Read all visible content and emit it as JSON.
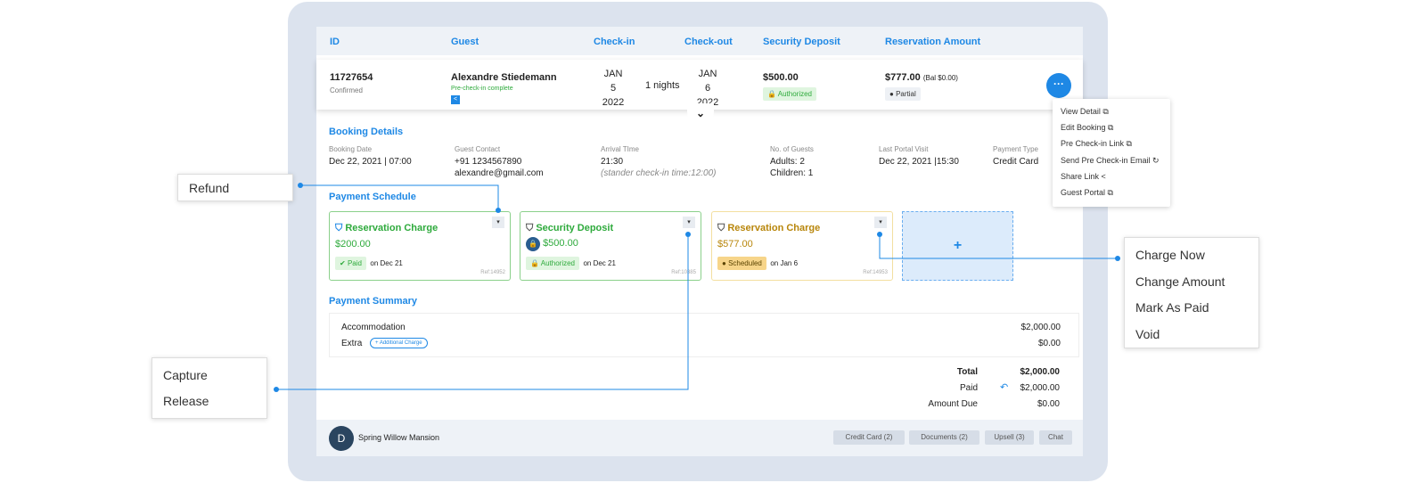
{
  "table": {
    "headers": [
      "ID",
      "Guest",
      "Check-in",
      "Check-out",
      "Security Deposit",
      "Reservation Amount"
    ]
  },
  "booking": {
    "id": "11727654",
    "status": "Confirmed",
    "guest": "Alexandre Stiedemann",
    "precheck": "Pre-check-in complete",
    "checkin": {
      "month": "JAN",
      "day": "5",
      "year": "2022"
    },
    "nights": "1 nights",
    "checkout": {
      "month": "JAN",
      "day": "6",
      "year": "2022"
    },
    "deposit": "$500.00",
    "deposit_status": "Authorized",
    "amount": "$777.00",
    "balance": "(Bal $0.00)",
    "amount_status": "Partial"
  },
  "details": {
    "title": "Booking Details",
    "booking_date_label": "Booking Date",
    "booking_date": "Dec 22, 2021 | 07:00",
    "contact_label": "Guest Contact",
    "phone": "+91 1234567890",
    "email": "alexandre@gmail.com",
    "arrival_label": "Arrival TIme",
    "arrival": "21:30",
    "arrival_note": "(stander check-in time:12:00)",
    "guests_label": "No. of Guests",
    "adults": "Adults: 2",
    "children": "Children: 1",
    "portal_label": "Last Portal Visit",
    "portal": "Dec 22, 2021 |15:30",
    "payment_label": "Payment Type",
    "payment": "Credit Card"
  },
  "menu": [
    "View Detail",
    "Edit Booking",
    "Pre Check-in Link",
    "Send Pre Check-in Email",
    "Share Link",
    "Guest Portal"
  ],
  "schedule": {
    "title": "Payment Schedule",
    "cards": [
      {
        "title": "Reservation Charge",
        "amount": "$200.00",
        "status": "Paid",
        "date": "on Dec 21",
        "ref": "Ref:14952"
      },
      {
        "title": "Security Deposit",
        "amount": "$500.00",
        "status": "Authorized",
        "date": "on Dec 21",
        "ref": "Ref:10385"
      },
      {
        "title": "Reservation Charge",
        "amount": "$577.00",
        "status": "Scheduled",
        "date": "on Jan 6",
        "ref": "Ref:14953"
      }
    ],
    "add": "+"
  },
  "summary": {
    "title": "Payment Summary",
    "accommodation": "Accommodation",
    "accommodation_amt": "$2,000.00",
    "extra": "Extra",
    "additional": "+ Additional Charge",
    "extra_amt": "$0.00",
    "total_label": "Total",
    "total": "$2,000.00",
    "paid_label": "Paid",
    "paid": "$2,000.00",
    "due_label": "Amount Due",
    "due": "$0.00"
  },
  "footer": {
    "avatar": "D",
    "property": "Spring Willow Mansion",
    "buttons": [
      "Credit Card (2)",
      "Documents (2)",
      "Upsell (3)",
      "Chat"
    ]
  },
  "callouts": {
    "refund": [
      "Refund"
    ],
    "deposit": [
      "Capture",
      "Release"
    ],
    "charge": [
      "Charge Now",
      "Change Amount",
      "Mark As Paid",
      "Void"
    ]
  },
  "colors": {
    "accent": "#1e88e5",
    "paid": "#2eaa3c",
    "scheduled": "#b8860b"
  }
}
